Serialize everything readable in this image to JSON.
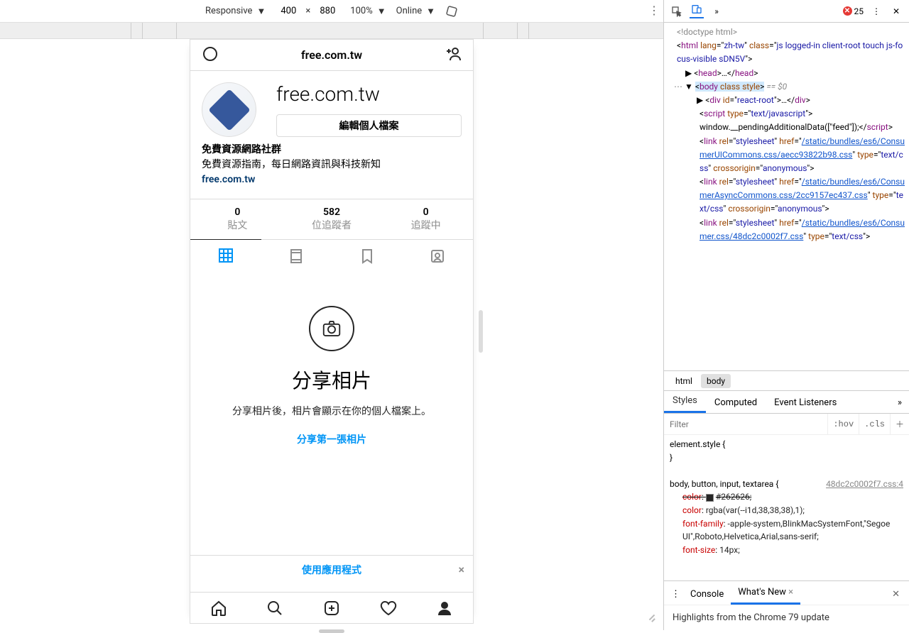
{
  "emu_toolbar": {
    "mode": "Responsive",
    "width": "400",
    "height": "880",
    "zoom": "100%",
    "throttle": "Online"
  },
  "devtools_toolbar": {
    "error_count": "25"
  },
  "ig": {
    "header_title": "free.com.tw",
    "username": "free.com.tw",
    "edit_profile": "編輯個人檔案",
    "bio_name": "免費資源網路社群",
    "bio_desc": "免費資源指南，每日網路資訊與科技新知",
    "bio_link": "free.com.tw",
    "stats": [
      {
        "num": "0",
        "lbl": "貼文"
      },
      {
        "num": "582",
        "lbl": "位追蹤者"
      },
      {
        "num": "0",
        "lbl": "追蹤中"
      }
    ],
    "empty_title": "分享相片",
    "empty_desc": "分享相片後，相片會顯示在你的個人檔案上。",
    "share_first": "分享第一張相片",
    "use_app": "使用應用程式"
  },
  "dom_tree": {
    "doctype": "<!doctype html>",
    "html_open": {
      "tag": "html",
      "attrs": [
        [
          "lang",
          "zh-tw"
        ],
        [
          "class",
          "js logged-in client-root touch js-focus-visible sDN5V"
        ]
      ]
    },
    "head": {
      "tag": "head",
      "ellipsis": "…"
    },
    "body_open": {
      "tag": "body",
      "attrs": [
        [
          "class",
          ""
        ],
        [
          "style",
          ""
        ]
      ],
      "selected": true,
      "eq": "== $0"
    },
    "react_root": {
      "tag": "div",
      "attrs": [
        [
          "id",
          "react-root"
        ]
      ],
      "ellipsis": "…"
    },
    "script_inline": {
      "tag": "script",
      "attrs": [
        [
          "type",
          "text/javascript"
        ]
      ],
      "content": "window.__pendingAdditionalData([\"feed\"]);"
    },
    "links": [
      {
        "href": "/static/bundles/es6/ConsumerUICommons.css/aecc93822b98.css",
        "type": "text/css",
        "cross": "anonymous"
      },
      {
        "href": "/static/bundles/es6/ConsumerAsyncCommons.css/2cc9157ec437.css",
        "type": "text/css",
        "cross": "anonymous"
      },
      {
        "href": "/static/bundles/es6/Consumer.css/48dc2c0002f7.css",
        "type": "text/css"
      }
    ]
  },
  "breadcrumb": [
    "html",
    "body"
  ],
  "styles_tabs": [
    "Styles",
    "Computed",
    "Event Listeners"
  ],
  "styles_filter": {
    "placeholder": "Filter",
    "hov": ":hov",
    "cls": ".cls"
  },
  "styles_rules": {
    "elem_style": "element.style {",
    "elem_style_close": "}",
    "selector": "body, button, input, textarea {",
    "src": "48dc2c0002f7.css:4",
    "props": [
      {
        "name": "color",
        "value": "#262626;",
        "strike": true,
        "swatch": true
      },
      {
        "name": "color",
        "value": "rgba(var(--i1d,38,38,38),1);"
      },
      {
        "name": "font-family",
        "value": "-apple-system,BlinkMacSystemFont,\"Segoe UI\",Roboto,Helvetica,Arial,sans-serif;"
      },
      {
        "name": "font-size",
        "value": "14px;"
      }
    ]
  },
  "drawer": {
    "tabs": [
      "Console",
      "What's New"
    ],
    "whats_new_text": "Highlights from the Chrome 79 update"
  }
}
